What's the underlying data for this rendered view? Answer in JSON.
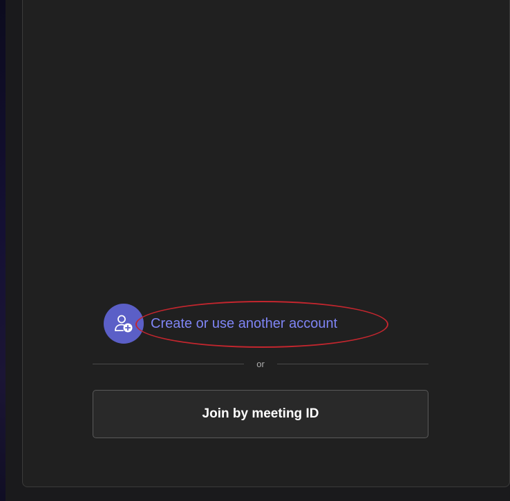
{
  "account": {
    "create_label": "Create or use another account",
    "icon": "person-add-icon"
  },
  "divider": {
    "text": "or"
  },
  "join": {
    "label": "Join by meeting ID"
  },
  "colors": {
    "accent": "#5b5fc7",
    "link": "#7f85f5",
    "highlight": "#c4262e",
    "card": "#202020"
  }
}
